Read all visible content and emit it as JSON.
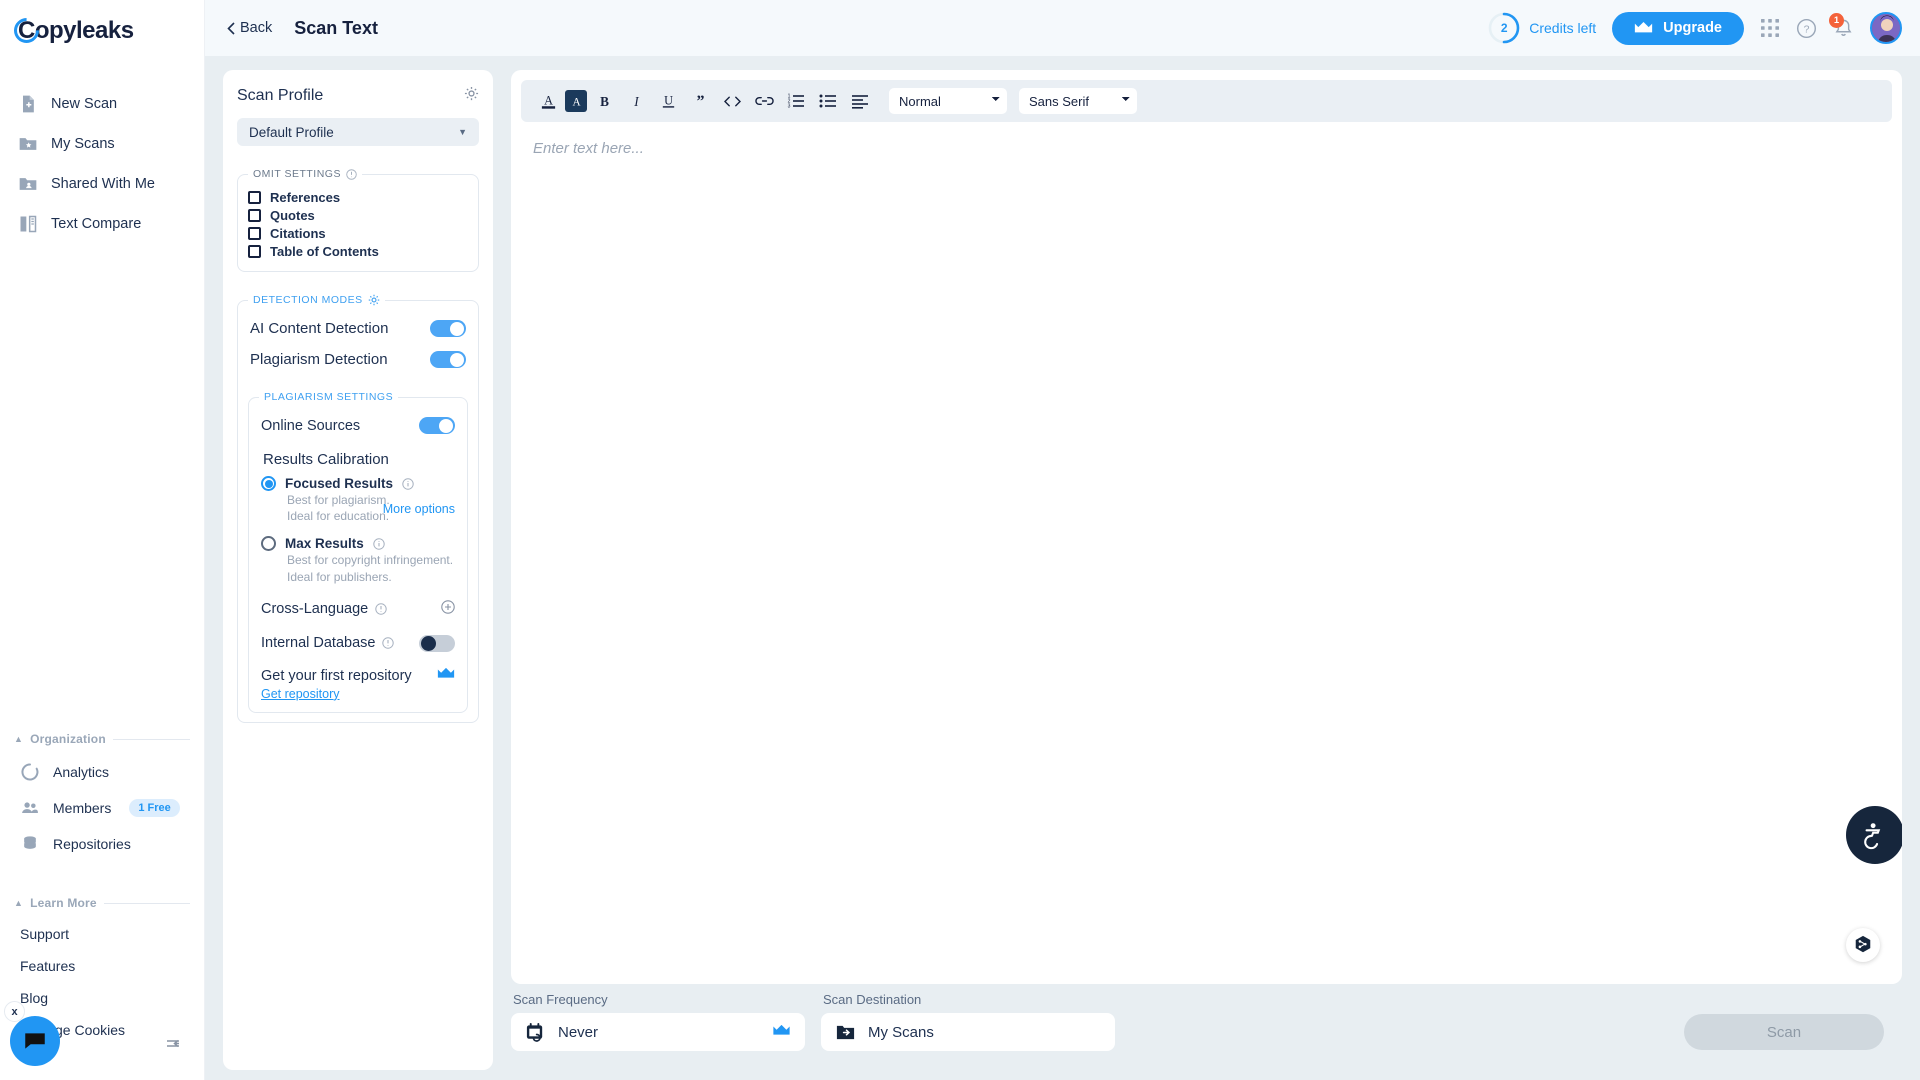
{
  "brand": {
    "name": "Copyleaks",
    "accent": "#2196f3",
    "dark": "#16213e"
  },
  "sidebar": {
    "nav": [
      {
        "label": "New Scan",
        "icon": "new-scan-icon"
      },
      {
        "label": "My Scans",
        "icon": "my-scans-icon"
      },
      {
        "label": "Shared With Me",
        "icon": "shared-with-me-icon"
      },
      {
        "label": "Text Compare",
        "icon": "text-compare-icon"
      }
    ],
    "organization": {
      "title": "Organization",
      "items": [
        {
          "label": "Analytics",
          "icon": "analytics-icon",
          "badge": ""
        },
        {
          "label": "Members",
          "icon": "members-icon",
          "badge": "1 Free"
        },
        {
          "label": "Repositories",
          "icon": "repositories-icon",
          "badge": ""
        }
      ]
    },
    "learn_more": {
      "title": "Learn More",
      "items": [
        {
          "label": "Support"
        },
        {
          "label": "Features"
        },
        {
          "label": "Blog"
        },
        {
          "label": "Manage Cookies"
        }
      ]
    },
    "chat_close_label": "x"
  },
  "topbar": {
    "back_label": "Back",
    "title": "Scan Text",
    "credits_count": "2",
    "credits_label": "Credits left",
    "upgrade_label": "Upgrade",
    "notification_count": "1"
  },
  "scan_profile": {
    "title": "Scan Profile",
    "selected_profile": "Default Profile",
    "omit": {
      "legend": "OMIT SETTINGS",
      "items": [
        {
          "label": "References",
          "checked": false
        },
        {
          "label": "Quotes",
          "checked": false
        },
        {
          "label": "Citations",
          "checked": false
        },
        {
          "label": "Table of Contents",
          "checked": false
        }
      ]
    },
    "detection": {
      "legend": "DETECTION MODES",
      "modes": [
        {
          "label": "AI Content Detection",
          "on": true
        },
        {
          "label": "Plagiarism Detection",
          "on": true
        }
      ]
    },
    "plagiarism": {
      "legend": "PLAGIARISM SETTINGS",
      "online_sources": {
        "label": "Online Sources",
        "on": true
      },
      "calibration_title": "Results Calibration",
      "more_options_label": "More options",
      "options": [
        {
          "label": "Focused Results",
          "desc_line1": "Best for plagiarism.",
          "desc_line2": "Ideal for education.",
          "selected": true
        },
        {
          "label": "Max Results",
          "desc_line1": "Best for copyright infringement.",
          "desc_line2": "Ideal for publishers.",
          "selected": false
        }
      ],
      "cross_language": {
        "label": "Cross-Language"
      },
      "internal_database": {
        "label": "Internal Database",
        "on": false
      },
      "repository_title": "Get your first repository",
      "repository_link": "Get repository"
    }
  },
  "editor": {
    "placeholder": "Enter text here...",
    "toolbar": {
      "buttons": [
        {
          "name": "text-color-icon",
          "glyph": "A"
        },
        {
          "name": "highlight-color-icon",
          "glyph": "A"
        },
        {
          "name": "bold-icon",
          "glyph": "B"
        },
        {
          "name": "italic-icon",
          "glyph": "I"
        },
        {
          "name": "underline-icon",
          "glyph": "U"
        },
        {
          "name": "blockquote-icon",
          "glyph": "”"
        },
        {
          "name": "code-block-icon",
          "glyph": "<>"
        },
        {
          "name": "link-icon",
          "glyph": "link"
        },
        {
          "name": "ordered-list-icon",
          "glyph": "ol"
        },
        {
          "name": "bullet-list-icon",
          "glyph": "ul"
        },
        {
          "name": "align-icon",
          "glyph": "align"
        }
      ],
      "heading_value": "Normal",
      "heading_options": [
        "Normal"
      ],
      "font_value": "Sans Serif",
      "font_options": [
        "Sans Serif"
      ]
    }
  },
  "bottom": {
    "frequency_label": "Scan Frequency",
    "frequency_value": "Never",
    "destination_label": "Scan Destination",
    "destination_value": "My Scans",
    "scan_button": "Scan"
  }
}
